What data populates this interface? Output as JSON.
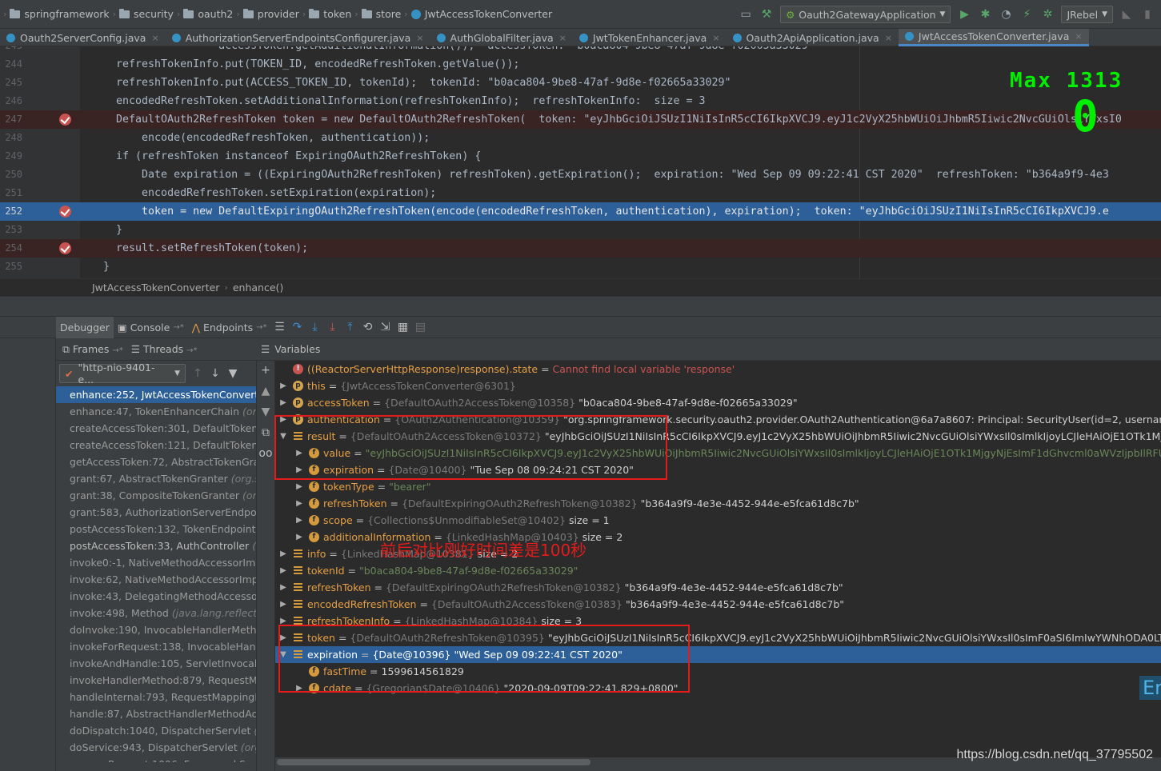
{
  "navbar": {
    "crumbs": [
      "springframework",
      "security",
      "oauth2",
      "provider",
      "token",
      "store"
    ],
    "current_class": "JwtAccessTokenConverter",
    "run_config": "Oauth2GatewayApplication",
    "jrebel": "JRebel"
  },
  "tabs": [
    {
      "label": "Oauth2ServerConfig.java",
      "active": false
    },
    {
      "label": "AuthorizationServerEndpointsConfigurer.java",
      "active": false
    },
    {
      "label": "AuthGlobalFilter.java",
      "active": false
    },
    {
      "label": "JwtTokenEnhancer.java",
      "active": false
    },
    {
      "label": "Oauth2ApiApplication.java",
      "active": false
    },
    {
      "label": "JwtAccessTokenConverter.java",
      "active": true
    }
  ],
  "editor": {
    "lines": [
      {
        "n": "243",
        "code": "                    accessToken.getAdditionalInformation());  accessToken: \"b0aca804-9be8-47af-9d8e-f02665a33029\""
      },
      {
        "n": "244",
        "code": "    refreshTokenInfo.put(TOKEN_ID, encodedRefreshToken.getValue());"
      },
      {
        "n": "245",
        "code": "    refreshTokenInfo.put(ACCESS_TOKEN_ID, tokenId);  tokenId: \"b0aca804-9be8-47af-9d8e-f02665a33029\""
      },
      {
        "n": "246",
        "code": "    encodedRefreshToken.setAdditionalInformation(refreshTokenInfo);  refreshTokenInfo:  size = 3"
      },
      {
        "n": "247",
        "code": "    DefaultOAuth2RefreshToken token = new DefaultOAuth2RefreshToken(  token: \"eyJhbGciOiJSUzI1NiIsInR5cCI6IkpXVCJ9.eyJ1c2VyX25hbWUiOiJhbmR5Iiwic2NvcGUiOlsiYWxsI0"
      },
      {
        "n": "248",
        "code": "        encode(encodedRefreshToken, authentication));"
      },
      {
        "n": "249",
        "code": "    if (refreshToken instanceof ExpiringOAuth2RefreshToken) {"
      },
      {
        "n": "250",
        "code": "        Date expiration = ((ExpiringOAuth2RefreshToken) refreshToken).getExpiration();  expiration: \"Wed Sep 09 09:22:41 CST 2020\"  refreshToken: \"b364a9f9-4e3"
      },
      {
        "n": "251",
        "code": "        encodedRefreshToken.setExpiration(expiration);"
      },
      {
        "n": "252",
        "code": "        token = new DefaultExpiringOAuth2RefreshToken(encode(encodedRefreshToken, authentication), expiration);  token: \"eyJhbGciOiJSUzI1NiIsInR5cCI6IkpXVCJ9.e"
      },
      {
        "n": "253",
        "code": "    }"
      },
      {
        "n": "254",
        "code": "    result.setRefreshToken(token);"
      },
      {
        "n": "255",
        "code": "  }"
      }
    ],
    "overlay_max": "Max  1313",
    "overlay_zero": "0"
  },
  "editor_crumb": [
    "JwtAccessTokenConverter",
    "enhance()"
  ],
  "debugger": {
    "tabs": [
      "Debugger",
      "Console",
      "Endpoints"
    ],
    "frames_label": "Frames",
    "threads_label": "Threads",
    "variables_label": "Variables",
    "thread": "\"http-nio-9401-e...",
    "frames": [
      {
        "text": "enhance:252, JwtAccessTokenConverter",
        "pkg": "",
        "sel": true,
        "lib": false
      },
      {
        "text": "enhance:47, TokenEnhancerChain ",
        "pkg": "(org.s",
        "sel": false,
        "lib": true
      },
      {
        "text": "createAccessToken:301, DefaultTokenSe",
        "pkg": "",
        "sel": false,
        "lib": true
      },
      {
        "text": "createAccessToken:121, DefaultTokenSe",
        "pkg": "",
        "sel": false,
        "lib": true
      },
      {
        "text": "getAccessToken:72, AbstractTokenGrant",
        "pkg": "",
        "sel": false,
        "lib": true
      },
      {
        "text": "grant:67, AbstractTokenGranter ",
        "pkg": "(org.sp",
        "sel": false,
        "lib": true
      },
      {
        "text": "grant:38, CompositeTokenGranter ",
        "pkg": "(org.",
        "sel": false,
        "lib": true
      },
      {
        "text": "grant:583, AuthorizationServerEndpoints",
        "pkg": "",
        "sel": false,
        "lib": true
      },
      {
        "text": "postAccessToken:132, TokenEndpoint ",
        "pkg": "(c",
        "sel": false,
        "lib": true
      },
      {
        "text": "postAccessToken:33, AuthController ",
        "pkg": "(co",
        "sel": false,
        "lib": false
      },
      {
        "text": "invoke0:-1, NativeMethodAccessorImpl ",
        "pkg": "",
        "sel": false,
        "lib": true
      },
      {
        "text": "invoke:62, NativeMethodAccessorImpl ",
        "pkg": "(",
        "sel": false,
        "lib": true
      },
      {
        "text": "invoke:43, DelegatingMethodAccessorIr",
        "pkg": "",
        "sel": false,
        "lib": true
      },
      {
        "text": "invoke:498, Method ",
        "pkg": "(java.lang.reflect)",
        "sel": false,
        "lib": true
      },
      {
        "text": "doInvoke:190, InvocableHandlerMethod",
        "pkg": "",
        "sel": false,
        "lib": true
      },
      {
        "text": "invokeForRequest:138, InvocableHandle",
        "pkg": "",
        "sel": false,
        "lib": true
      },
      {
        "text": "invokeAndHandle:105, ServletInvocable",
        "pkg": "",
        "sel": false,
        "lib": true
      },
      {
        "text": "invokeHandlerMethod:879, RequestMap",
        "pkg": "",
        "sel": false,
        "lib": true
      },
      {
        "text": "handleInternal:793, RequestMappingHa",
        "pkg": "",
        "sel": false,
        "lib": true
      },
      {
        "text": "handle:87, AbstractHandlerMethodAdap",
        "pkg": "",
        "sel": false,
        "lib": true
      },
      {
        "text": "doDispatch:1040, DispatcherServlet ",
        "pkg": "(org",
        "sel": false,
        "lib": true
      },
      {
        "text": "doService:943, DispatcherServlet ",
        "pkg": "(org.sp",
        "sel": false,
        "lib": true
      },
      {
        "text": "processRequest:1006, FrameworkServle",
        "pkg": "",
        "sel": false,
        "lib": true
      }
    ],
    "variables": [
      {
        "indent": 0,
        "tri": "",
        "icon": "e",
        "name": "((ReactorServerHttpResponse)response).state",
        "type": "",
        "val": "Cannot find local variable 'response'",
        "err": true
      },
      {
        "indent": 0,
        "tri": "▶",
        "icon": "p",
        "name": "this",
        "type": "{JwtAccessTokenConverter@6301}",
        "val": ""
      },
      {
        "indent": 0,
        "tri": "▶",
        "icon": "p",
        "name": "accessToken",
        "type": "{DefaultOAuth2AccessToken@10358}",
        "val": "\"b0aca804-9be8-47af-9d8e-f02665a33029\""
      },
      {
        "indent": 0,
        "tri": "▶",
        "icon": "p",
        "name": "authentication",
        "type": "{OAuth2Authentication@10359}",
        "val": "\"org.springframework.security.oauth2.provider.OAuth2Authentication@6a7a8607: Principal: SecurityUser(id=2, username=andy, passwo"
      },
      {
        "indent": 0,
        "tri": "▼",
        "icon": "l",
        "name": "result",
        "type": "{DefaultOAuth2AccessToken@10372}",
        "val": "\"eyJhbGciOiJSUzI1NiIsInR5cCI6IkpXVCJ9.eyJ1c2VyX25hbWUiOiJhbmR5Iiwic2NvcGUiOlsiYWxsIl0sImlkIjoyLCJleHAiOjE1OTk1MjgyNjEsImF1d"
      },
      {
        "indent": 1,
        "tri": "▶",
        "icon": "f",
        "name": "value",
        "type": "",
        "val": "\"eyJhbGciOiJSUzI1NiIsInR5cCI6IkpXVCJ9.eyJ1c2VyX25hbWUiOiJhbmR5Iiwic2NvcGUiOlsiYWxsIl0sImlkIjoyLCJleHAiOjE1OTk1MjgyNjEsImF1dGhvcml0aWVzIjpbIlRFU1QiXSwianRpIjoiY",
        "str": true
      },
      {
        "indent": 1,
        "tri": "▶",
        "icon": "f",
        "name": "expiration",
        "type": "{Date@10400}",
        "val": "\"Tue Sep 08 09:24:21 CST 2020\""
      },
      {
        "indent": 1,
        "tri": "▶",
        "icon": "f",
        "name": "tokenType",
        "type": "",
        "val": "\"bearer\"",
        "str": true
      },
      {
        "indent": 1,
        "tri": "▶",
        "icon": "f",
        "name": "refreshToken",
        "type": "{DefaultExpiringOAuth2RefreshToken@10382}",
        "val": "\"b364a9f9-4e3e-4452-944e-e5fca61d8c7b\""
      },
      {
        "indent": 1,
        "tri": "▶",
        "icon": "f",
        "name": "scope",
        "type": "{Collections$UnmodifiableSet@10402}",
        "val": "size = 1"
      },
      {
        "indent": 1,
        "tri": "▶",
        "icon": "f",
        "name": "additionalInformation",
        "type": "{LinkedHashMap@10403}",
        "val": "size = 2"
      },
      {
        "indent": 0,
        "tri": "▶",
        "icon": "l",
        "name": "info",
        "type": "{LinkedHashMap@10381}",
        "val": "size = 2"
      },
      {
        "indent": 0,
        "tri": "▶",
        "icon": "l",
        "name": "tokenId",
        "type": "",
        "val": "\"b0aca804-9be8-47af-9d8e-f02665a33029\"",
        "str": true
      },
      {
        "indent": 0,
        "tri": "▶",
        "icon": "l",
        "name": "refreshToken",
        "type": "{DefaultExpiringOAuth2RefreshToken@10382}",
        "val": "\"b364a9f9-4e3e-4452-944e-e5fca61d8c7b\""
      },
      {
        "indent": 0,
        "tri": "▶",
        "icon": "l",
        "name": "encodedRefreshToken",
        "type": "{DefaultOAuth2AccessToken@10383}",
        "val": "\"b364a9f9-4e3e-4452-944e-e5fca61d8c7b\""
      },
      {
        "indent": 0,
        "tri": "▶",
        "icon": "l",
        "name": "refreshTokenInfo",
        "type": "{LinkedHashMap@10384}",
        "val": "size = 3"
      },
      {
        "indent": 0,
        "tri": "▶",
        "icon": "l",
        "name": "token",
        "type": "{DefaultOAuth2RefreshToken@10395}",
        "val": "\"eyJhbGciOiJSUzI1NiIsInR5cCI6IkpXVCJ9.eyJ1c2VyX25hbWUiOiJhbmR5Iiwic2NvcGUiOlsiYWxsIl0sImF0aSI6ImIwYWNhODA0LTliZTgtNDdhZ"
      },
      {
        "indent": 0,
        "tri": "▼",
        "icon": "l",
        "name": "expiration",
        "type": "{Date@10396}",
        "val": "\"Wed Sep 09 09:22:41 CST 2020\"",
        "sel": true
      },
      {
        "indent": 1,
        "tri": "",
        "icon": "f",
        "name": "fastTime",
        "type": "",
        "val": "1599614561829"
      },
      {
        "indent": 1,
        "tri": "▶",
        "icon": "f",
        "name": "cdate",
        "type": "{Gregorian$Date@10406}",
        "val": "\"2020-09-09T09:22:41.829+0800\""
      }
    ]
  },
  "annotation": "前后对比刚好时间差是100秒",
  "watermark": "https://blog.csdn.net/qq_37795502",
  "en_badge": "En",
  "colors": {
    "accent": "#2d6099",
    "annotation": "#e31b1b",
    "overlay": "#00f000"
  }
}
